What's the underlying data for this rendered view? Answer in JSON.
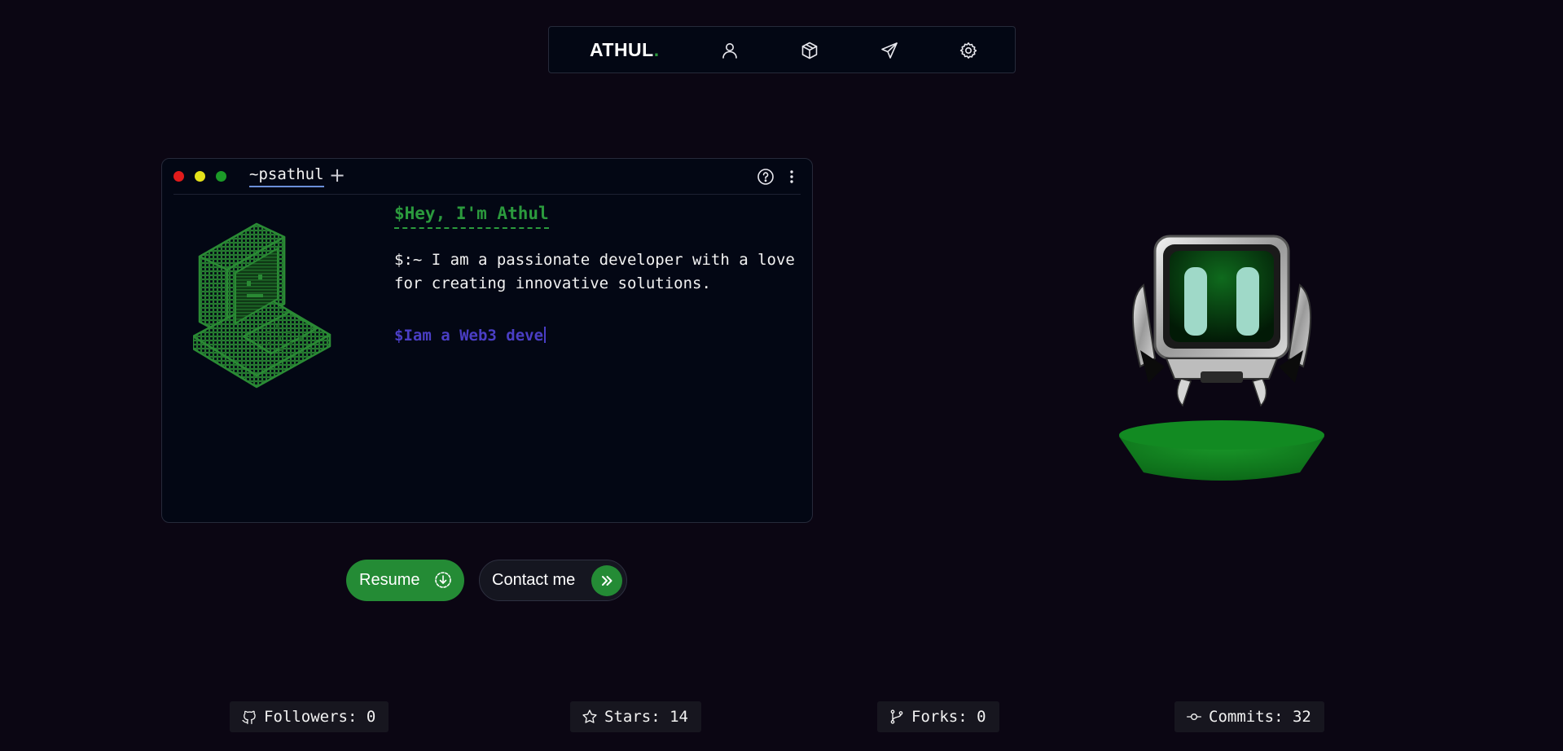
{
  "nav": {
    "logo": "ATHUL",
    "logo_dot": ".",
    "items": [
      {
        "icon": "user-icon"
      },
      {
        "icon": "cube-icon"
      },
      {
        "icon": "send-icon"
      },
      {
        "icon": "gear-icon"
      }
    ]
  },
  "terminal": {
    "tab_label": "~psathul",
    "add_tab": "+",
    "heading": "$Hey, I'm Athul",
    "description": "$:~ I am a passionate developer with a love for creating innovative solutions.",
    "typed_text": "$Iam a Web3 deve",
    "window_dots": [
      "#e21b1b",
      "#e5e21a",
      "#1c9a28"
    ]
  },
  "buttons": {
    "resume": "Resume",
    "contact": "Contact me"
  },
  "stats": {
    "followers": "Followers: 0",
    "stars": "Stars: 14",
    "forks": "Forks: 0",
    "commits": "Commits: 32"
  },
  "colors": {
    "background": "#0b0613",
    "accent_green": "#2b9a3d",
    "typed_purple": "#4a3ec5",
    "panel": "#030714"
  }
}
